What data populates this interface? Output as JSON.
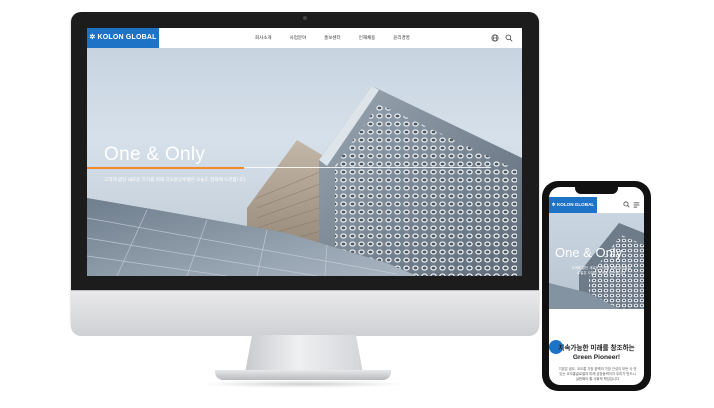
{
  "desktop": {
    "logo": "KOLON GLOBAL",
    "nav": [
      "회사소개",
      "사업분야",
      "홍보센터",
      "인재채용",
      "윤리경영"
    ],
    "hero": {
      "title": "One & Only",
      "subtitle": "고객에 없던 새로운 가치를 위해 코오롱글로벌은 오늘도 현재에 도전합니다"
    }
  },
  "mobile": {
    "logo": "KOLON GLOBAL",
    "hero": {
      "title": "One & Only",
      "subtitle": "고객에 없던 새로운 가치를 위해 코오롱글로벌은 오늘도 현재에 도전합니다"
    },
    "section_title_line1": "지속가능한 미래를 창조하는",
    "section_title_line2": "Green Pioneer!",
    "section_body": "기본은 쉽도, 코오롱 가장 완벽의 가장 근성이 모든 사 전 있는 코오롱글로벌의 미래 성장동력이자 우리가 반드시 실현해야 할 사회적 책임입니다"
  },
  "icons": [
    "globe-icon",
    "search-icon",
    "menu-icon"
  ],
  "colors": {
    "brand": "#1f73c7",
    "accent": "#f08a2a"
  }
}
